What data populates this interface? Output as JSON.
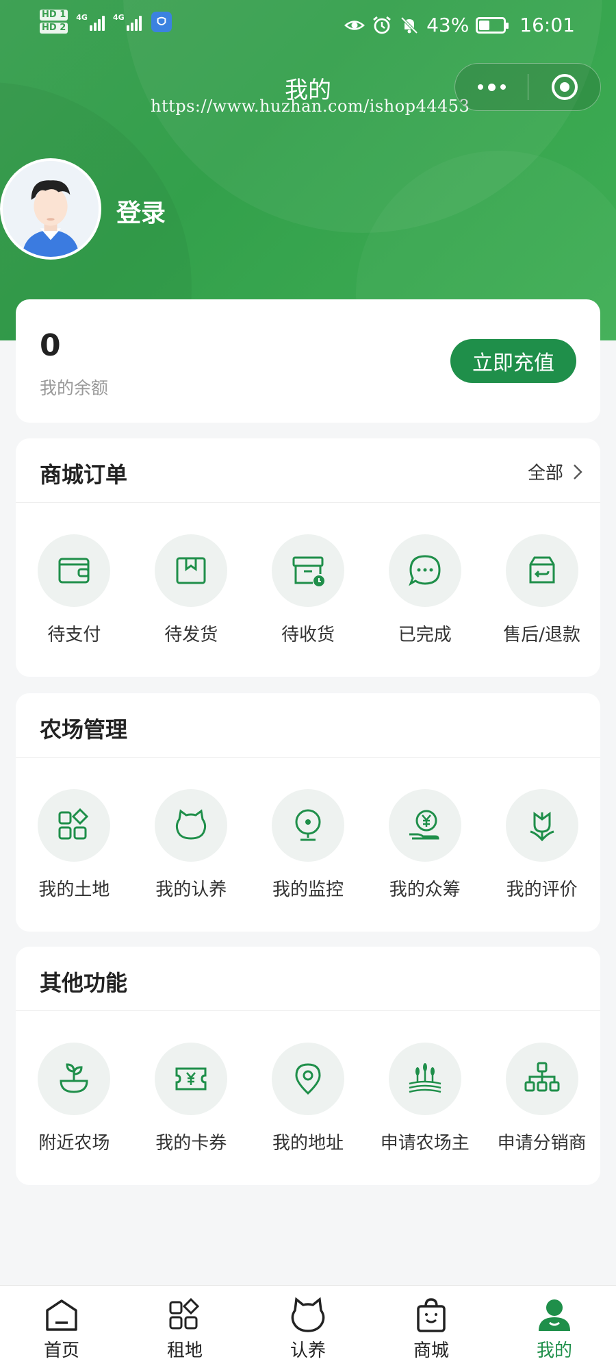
{
  "status_bar": {
    "hd1": "HD 1",
    "hd2": "HD 2",
    "net1": "4G",
    "net2": "4G",
    "battery": "43%",
    "time": "16:01"
  },
  "nav": {
    "title": "我的",
    "watermark": "https://www.huzhan.com/ishop44453"
  },
  "user": {
    "login": "登录"
  },
  "balance": {
    "value": "0",
    "label": "我的余额",
    "recharge": "立即充值"
  },
  "orders": {
    "title": "商城订单",
    "more": "全部",
    "items": [
      {
        "label": "待支付",
        "icon": "wallet-icon"
      },
      {
        "label": "待发货",
        "icon": "package-icon"
      },
      {
        "label": "待收货",
        "icon": "delivery-box-icon"
      },
      {
        "label": "已完成",
        "icon": "chat-bubble-icon"
      },
      {
        "label": "售后/退款",
        "icon": "return-box-icon"
      }
    ]
  },
  "farm": {
    "title": "农场管理",
    "items": [
      {
        "label": "我的土地",
        "icon": "land-grid-icon"
      },
      {
        "label": "我的认养",
        "icon": "cat-icon"
      },
      {
        "label": "我的监控",
        "icon": "camera-icon"
      },
      {
        "label": "我的众筹",
        "icon": "yuan-hand-icon"
      },
      {
        "label": "我的评价",
        "icon": "flower-icon"
      }
    ]
  },
  "other": {
    "title": "其他功能",
    "items": [
      {
        "label": "附近农场",
        "icon": "sprout-bowl-icon"
      },
      {
        "label": "我的卡券",
        "icon": "coupon-icon"
      },
      {
        "label": "我的地址",
        "icon": "location-pin-icon"
      },
      {
        "label": "申请农场主",
        "icon": "wheat-field-icon"
      },
      {
        "label": "申请分销商",
        "icon": "hierarchy-icon"
      }
    ]
  },
  "tabbar": {
    "items": [
      {
        "label": "首页",
        "icon": "home-icon"
      },
      {
        "label": "租地",
        "icon": "grid-icon"
      },
      {
        "label": "认养",
        "icon": "cat-icon"
      },
      {
        "label": "商城",
        "icon": "shopping-bag-icon"
      },
      {
        "label": "我的",
        "icon": "user-icon"
      }
    ],
    "active": "我的"
  },
  "colors": {
    "brand_green": "#1f8f4a",
    "header_green": "#3aa152",
    "icon_bg": "#eef2f0",
    "page_bg": "#f5f6f7"
  }
}
